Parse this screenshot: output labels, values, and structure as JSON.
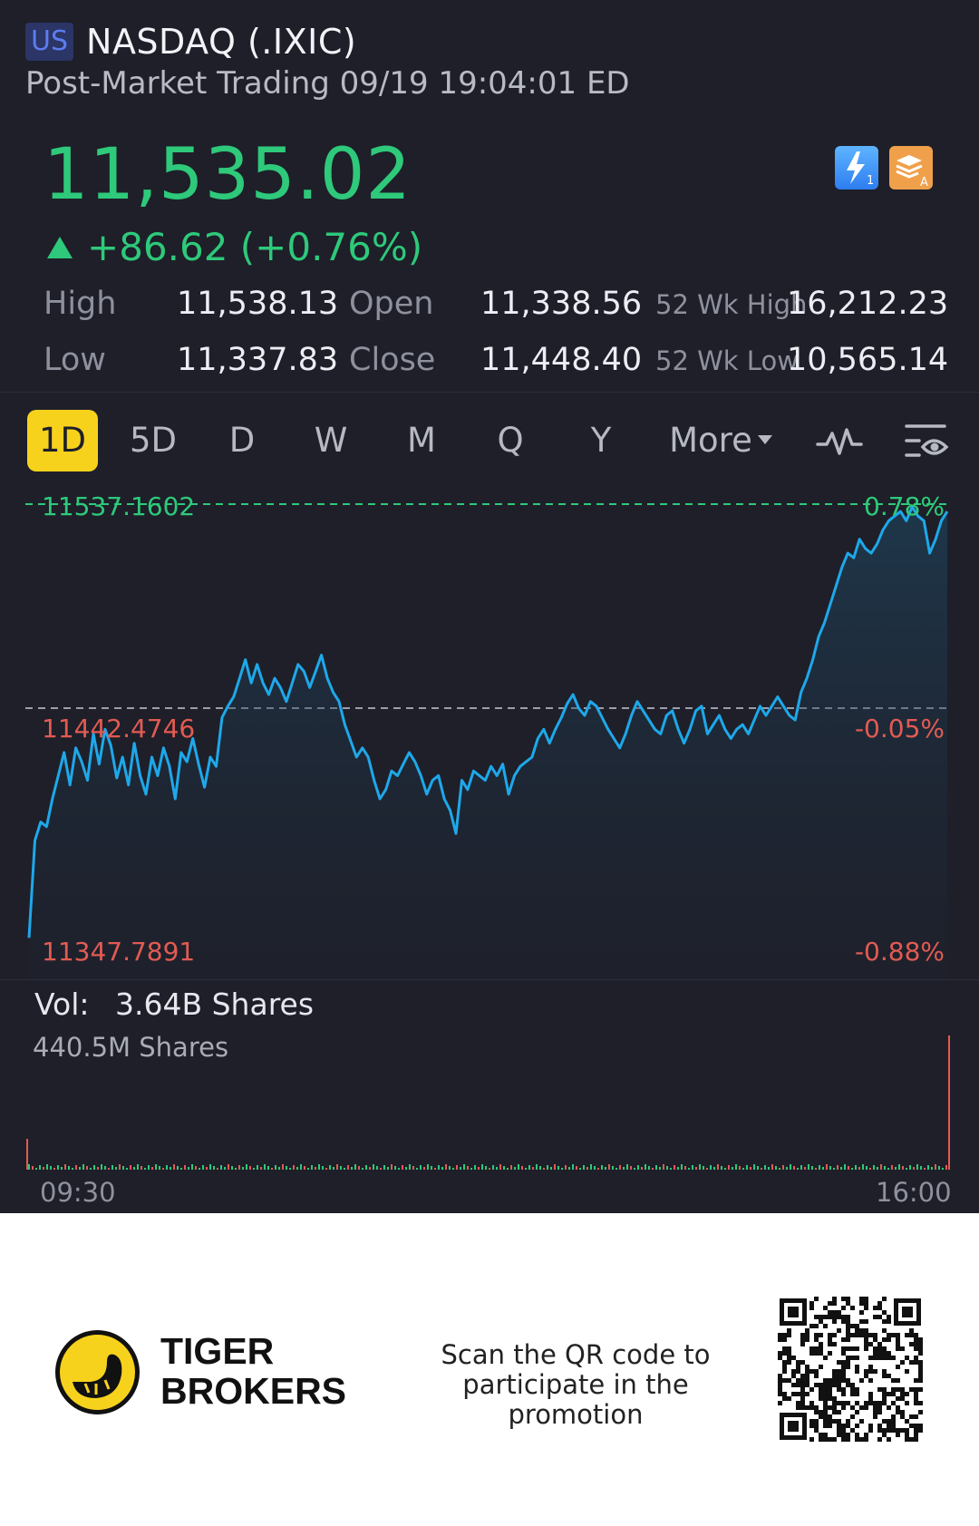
{
  "header": {
    "market_badge": "US",
    "title": "NASDAQ (.IXIC)",
    "subtitle": "Post-Market Trading 09/19 19:04:01 ED"
  },
  "quote": {
    "price": "11,535.02",
    "change": "+86.62 (+0.76%)",
    "up_color": "#2ec97a",
    "icons": [
      "lightning-1-icon",
      "layers-a-icon"
    ]
  },
  "stats": {
    "high_label": "High",
    "high_value": "11,538.13",
    "low_label": "Low",
    "low_value": "11,337.83",
    "open_label": "Open",
    "open_value": "11,338.56",
    "close_label": "Close",
    "close_value": "11,448.40",
    "wk52_high_label": "52 Wk High",
    "wk52_high_value": "16,212.23",
    "wk52_low_label": "52 Wk Low",
    "wk52_low_value": "10,565.14"
  },
  "tabs": {
    "items": [
      "1D",
      "5D",
      "D",
      "W",
      "M",
      "Q",
      "Y"
    ],
    "active": "1D",
    "more": "More",
    "active_color": "#f7d21c"
  },
  "chart": {
    "top_price_label": "11537.1602",
    "top_pct_label": "0.78%",
    "mid_price_label": "11442.4746",
    "mid_pct_label": "-0.05%",
    "bottom_price_label": "11347.7891",
    "bottom_pct_label": "-0.88%",
    "line_color": "#1ea8ea",
    "down_color": "#e25b52"
  },
  "volume": {
    "label": "Vol:",
    "value": "3.64B Shares",
    "scale_label": "440.5M Shares",
    "start_time": "09:30",
    "end_time": "16:00"
  },
  "footer": {
    "brand_line1": "TIGER",
    "brand_line2": "BROKERS",
    "promo_text": "Scan the QR code to participate in the promotion"
  },
  "chart_data": {
    "type": "line",
    "y_range": [
      11347.7891,
      11537.1602
    ],
    "reference_close": 11448.4,
    "x_labels": [
      "09:30",
      "16:00"
    ],
    "values": [
      11350,
      11392,
      11400,
      11398,
      11410,
      11420,
      11430,
      11416,
      11432,
      11426,
      11418,
      11438,
      11425,
      11440,
      11433,
      11419,
      11428,
      11416,
      11434,
      11420,
      11412,
      11428,
      11420,
      11432,
      11424,
      11410,
      11430,
      11426,
      11436,
      11425,
      11415,
      11428,
      11424,
      11445,
      11450,
      11454,
      11462,
      11470,
      11460,
      11468,
      11460,
      11455,
      11462,
      11458,
      11452,
      11460,
      11468,
      11465,
      11458,
      11465,
      11472,
      11462,
      11456,
      11452,
      11442,
      11435,
      11428,
      11432,
      11428,
      11418,
      11410,
      11414,
      11422,
      11420,
      11425,
      11430,
      11426,
      11420,
      11412,
      11418,
      11420,
      11410,
      11405,
      11395,
      11418,
      11414,
      11422,
      11420,
      11418,
      11424,
      11420,
      11425,
      11412,
      11420,
      11424,
      11426,
      11428,
      11436,
      11440,
      11434,
      11440,
      11445,
      11451,
      11455,
      11449,
      11446,
      11452,
      11450,
      11445,
      11440,
      11436,
      11432,
      11438,
      11446,
      11452,
      11448,
      11444,
      11440,
      11438,
      11446,
      11448,
      11440,
      11434,
      11440,
      11448,
      11450,
      11438,
      11442,
      11446,
      11440,
      11436,
      11440,
      11442,
      11438,
      11444,
      11450,
      11446,
      11450,
      11454,
      11450,
      11446,
      11444,
      11456,
      11462,
      11470,
      11480,
      11486,
      11494,
      11502,
      11510,
      11516,
      11514,
      11522,
      11518,
      11516,
      11520,
      11526,
      11530,
      11532,
      11534,
      11530,
      11536,
      11532,
      11530,
      11516,
      11522,
      11530,
      11534
    ]
  }
}
